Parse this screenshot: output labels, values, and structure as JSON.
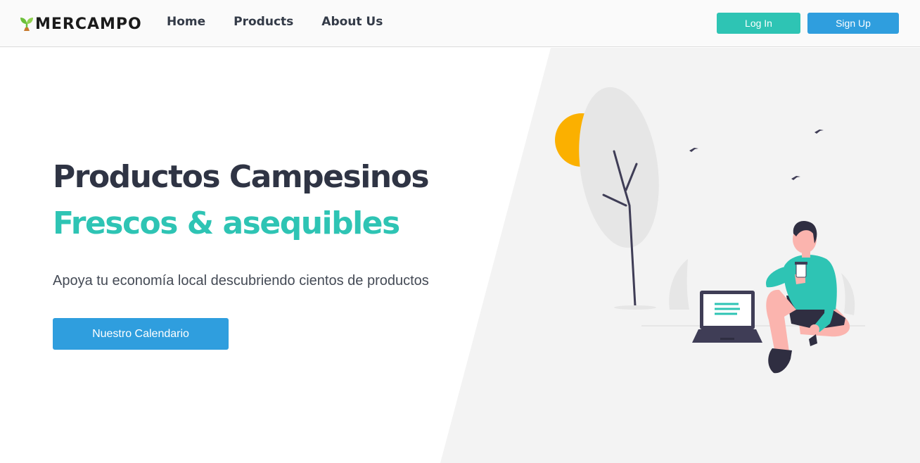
{
  "brand": {
    "name": "MERCAMPO",
    "icon": "sprout-icon",
    "icon_color": "#6bbf3a"
  },
  "nav": {
    "items": [
      {
        "label": "Home"
      },
      {
        "label": "Products"
      },
      {
        "label": "About Us"
      }
    ],
    "login_label": "Log In",
    "signup_label": "Sign Up"
  },
  "hero": {
    "title_line1": "Productos Campesinos",
    "title_line2": "Frescos & asequibles",
    "subtitle": "Apoya tu economía local descubriendo cientos de productos",
    "cta_label": "Nuestro Calendario"
  },
  "colors": {
    "accent_teal": "#2ec4b4",
    "accent_blue": "#2f9ede",
    "heading_dark": "#2f3444",
    "sun": "#fbb000",
    "skin": "#fbb4ae"
  }
}
